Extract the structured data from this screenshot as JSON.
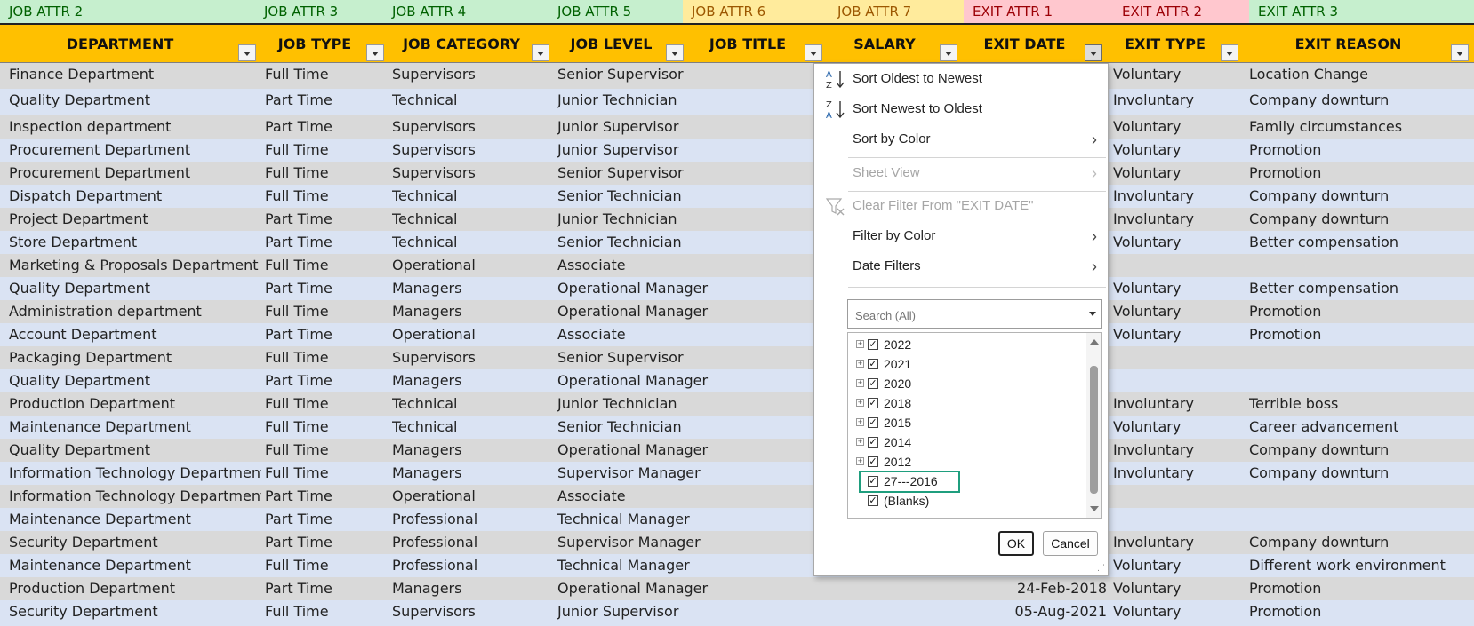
{
  "attr_headers": [
    {
      "label": "JOB ATTR 2",
      "bg": "#c6efce",
      "color": "#006100"
    },
    {
      "label": "JOB ATTR 3",
      "bg": "#c6efce",
      "color": "#006100"
    },
    {
      "label": "JOB ATTR 4",
      "bg": "#c6efce",
      "color": "#006100"
    },
    {
      "label": "JOB ATTR 5",
      "bg": "#c6efce",
      "color": "#006100"
    },
    {
      "label": "JOB ATTR 6",
      "bg": "#ffeb9c",
      "color": "#9c5700"
    },
    {
      "label": "JOB ATTR 7",
      "bg": "#ffeb9c",
      "color": "#9c5700"
    },
    {
      "label": "EXIT ATTR 1",
      "bg": "#ffc7ce",
      "color": "#9c0006"
    },
    {
      "label": "EXIT ATTR 2",
      "bg": "#ffc7ce",
      "color": "#9c0006"
    },
    {
      "label": "EXIT ATTR 3",
      "bg": "#c6efce",
      "color": "#006100"
    }
  ],
  "headers": [
    "DEPARTMENT",
    "JOB TYPE",
    "JOB CATEGORY",
    "JOB LEVEL",
    "JOB TITLE",
    "SALARY",
    "EXIT DATE",
    "EXIT TYPE",
    "EXIT REASON"
  ],
  "header_bg": "#ffc000",
  "rows": [
    {
      "dept": "Finance Department",
      "type": "Full Time",
      "cat": "Supervisors",
      "level": "Senior Supervisor",
      "date": "",
      "exit_type": "Voluntary",
      "reason": "Location Change"
    },
    {
      "dept": "Quality Department",
      "type": "Part Time",
      "cat": "Technical",
      "level": "Junior Technician",
      "date": "",
      "exit_type": "Involuntary",
      "reason": "Company downturn"
    },
    {
      "dept": "Inspection department",
      "type": "Part Time",
      "cat": "Supervisors",
      "level": "Junior Supervisor",
      "date": "",
      "exit_type": "Voluntary",
      "reason": "Family circumstances"
    },
    {
      "dept": "Procurement Department",
      "type": "Full Time",
      "cat": "Supervisors",
      "level": "Junior Supervisor",
      "date": "",
      "exit_type": "Voluntary",
      "reason": "Promotion"
    },
    {
      "dept": "Procurement Department",
      "type": "Full Time",
      "cat": "Supervisors",
      "level": "Senior Supervisor",
      "date": "",
      "exit_type": "Voluntary",
      "reason": "Promotion"
    },
    {
      "dept": "Dispatch Department",
      "type": "Full Time",
      "cat": "Technical",
      "level": "Senior Technician",
      "date": "",
      "exit_type": "Involuntary",
      "reason": "Company downturn"
    },
    {
      "dept": "Project Department",
      "type": "Part Time",
      "cat": "Technical",
      "level": "Junior Technician",
      "date": "",
      "exit_type": "Involuntary",
      "reason": "Company downturn"
    },
    {
      "dept": "Store Department",
      "type": "Part Time",
      "cat": "Technical",
      "level": "Senior Technician",
      "date": "",
      "exit_type": "Voluntary",
      "reason": "Better compensation"
    },
    {
      "dept": "Marketing & Proposals Department",
      "type": "Full Time",
      "cat": "Operational",
      "level": "Associate",
      "date": "",
      "exit_type": "",
      "reason": ""
    },
    {
      "dept": "Quality Department",
      "type": "Part Time",
      "cat": "Managers",
      "level": "Operational Manager",
      "date": "",
      "exit_type": "Voluntary",
      "reason": "Better compensation"
    },
    {
      "dept": "Administration department",
      "type": "Full Time",
      "cat": "Managers",
      "level": "Operational Manager",
      "date": "",
      "exit_type": "Voluntary",
      "reason": "Promotion"
    },
    {
      "dept": "Account Department",
      "type": "Part Time",
      "cat": "Operational",
      "level": "Associate",
      "date": "",
      "exit_type": "Voluntary",
      "reason": "Promotion"
    },
    {
      "dept": "Packaging Department",
      "type": "Full Time",
      "cat": "Supervisors",
      "level": "Senior Supervisor",
      "date": "",
      "exit_type": "",
      "reason": ""
    },
    {
      "dept": "Quality Department",
      "type": "Part Time",
      "cat": "Managers",
      "level": "Operational Manager",
      "date": "",
      "exit_type": "",
      "reason": ""
    },
    {
      "dept": "Production Department",
      "type": "Full Time",
      "cat": "Technical",
      "level": "Junior Technician",
      "date": "",
      "exit_type": "Involuntary",
      "reason": "Terrible boss"
    },
    {
      "dept": "Maintenance Department",
      "type": "Full Time",
      "cat": "Technical",
      "level": "Senior Technician",
      "date": "",
      "exit_type": "Voluntary",
      "reason": "Career advancement"
    },
    {
      "dept": "Quality Department",
      "type": "Full Time",
      "cat": "Managers",
      "level": "Operational Manager",
      "date": "",
      "exit_type": "Involuntary",
      "reason": "Company downturn"
    },
    {
      "dept": "Information Technology Department",
      "type": "Full Time",
      "cat": "Managers",
      "level": "Supervisor Manager",
      "date": "",
      "exit_type": "Involuntary",
      "reason": "Company downturn"
    },
    {
      "dept": "Information Technology Department",
      "type": "Part Time",
      "cat": "Operational",
      "level": "Associate",
      "date": "",
      "exit_type": "",
      "reason": ""
    },
    {
      "dept": "Maintenance Department",
      "type": "Part Time",
      "cat": "Professional",
      "level": "Technical Manager",
      "date": "",
      "exit_type": "",
      "reason": ""
    },
    {
      "dept": "Security Department",
      "type": "Part Time",
      "cat": "Professional",
      "level": "Supervisor Manager",
      "date": "",
      "exit_type": "Involuntary",
      "reason": "Company downturn"
    },
    {
      "dept": "Maintenance Department",
      "type": "Full Time",
      "cat": "Professional",
      "level": "Technical Manager",
      "date": "",
      "exit_type": "Voluntary",
      "reason": "Different work environment"
    },
    {
      "dept": "Production Department",
      "type": "Part Time",
      "cat": "Managers",
      "level": "Operational Manager",
      "date": "24-Feb-2018",
      "exit_type": "Voluntary",
      "reason": "Promotion"
    },
    {
      "dept": "Security Department",
      "type": "Full Time",
      "cat": "Supervisors",
      "level": "Junior Supervisor",
      "date": "05-Aug-2021",
      "exit_type": "Voluntary",
      "reason": "Promotion"
    }
  ],
  "filter_menu": {
    "sort_asc": "Sort Oldest to Newest",
    "sort_desc": "Sort Newest to Oldest",
    "sort_color": "Sort by Color",
    "sheet_view": "Sheet View",
    "clear_filter": "Clear Filter From \"EXIT DATE\"",
    "filter_color": "Filter by Color",
    "date_filters": "Date Filters",
    "search_placeholder": "Search (All)",
    "items": [
      {
        "label": "2022",
        "expandable": true,
        "checked": true
      },
      {
        "label": "2021",
        "expandable": true,
        "checked": true
      },
      {
        "label": "2020",
        "expandable": true,
        "checked": true
      },
      {
        "label": "2018",
        "expandable": true,
        "checked": true
      },
      {
        "label": "2015",
        "expandable": true,
        "checked": true
      },
      {
        "label": "2014",
        "expandable": true,
        "checked": true
      },
      {
        "label": "2012",
        "expandable": true,
        "checked": true
      },
      {
        "label": "27---2016",
        "expandable": false,
        "checked": true,
        "highlighted": true
      },
      {
        "label": "(Blanks)",
        "expandable": false,
        "checked": true
      }
    ],
    "ok_label": "OK",
    "cancel_label": "Cancel",
    "highlight_color": "#1f9e7e"
  },
  "icons": {
    "sort_asc": "sort-az-icon",
    "sort_desc": "sort-za-icon",
    "clear_filter": "filter-clear-icon"
  },
  "row_colors": {
    "even": "#d9d9d9",
    "odd": "#dae3f3"
  }
}
